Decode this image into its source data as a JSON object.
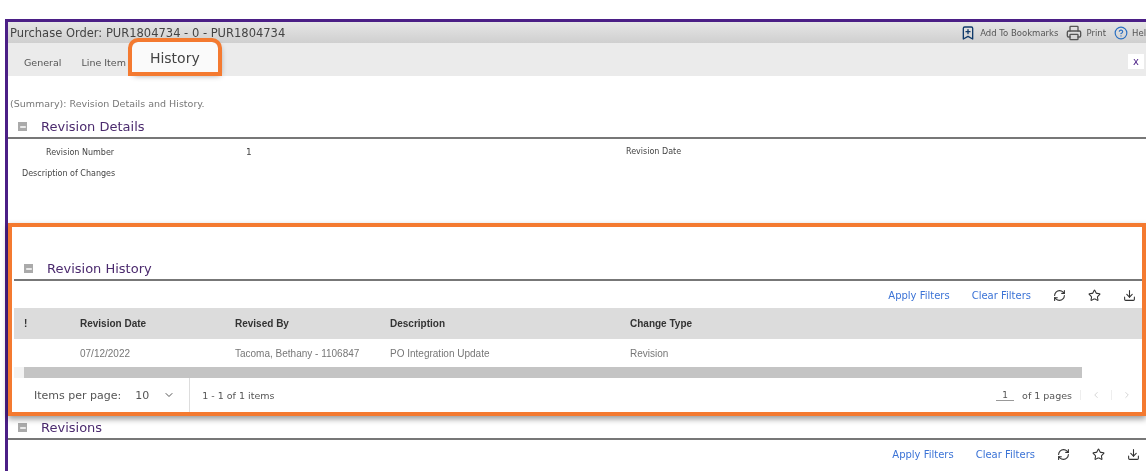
{
  "header": {
    "title": "Purchase Order: PUR1804734 - 0 - PUR1804734",
    "actions": [
      {
        "kind": "bookmark",
        "label": "Add To Bookmarks"
      },
      {
        "kind": "print",
        "label": "Print"
      },
      {
        "kind": "help",
        "label": "Hel"
      }
    ]
  },
  "tabs": [
    {
      "label": "General",
      "selected": false
    },
    {
      "label": "Line Item",
      "selected": false
    },
    {
      "label": "History",
      "selected": true
    }
  ],
  "close_label": "x",
  "summary": "(Summary): Revision Details and History.",
  "revision_details": {
    "title": "Revision Details",
    "fields": [
      {
        "label": "Revision Number",
        "value": "1"
      },
      {
        "label": "Revision Date"
      },
      {
        "label": "Description of Changes"
      }
    ]
  },
  "revision_history": {
    "title": "Revision History",
    "toolbar": [
      "Apply Filters",
      "Clear Filters"
    ],
    "table": {
      "columns": [
        "!",
        "Revision Date",
        "Revised By",
        "Description",
        "Change Type"
      ],
      "rows": [
        [
          "",
          "07/12/2022",
          "Tacoma, Bethany - 1106847",
          "PO Integration Update",
          "Revision"
        ]
      ]
    },
    "pager": {
      "items_per_page_label": "Items per page:",
      "items_per_page": "10",
      "range": "1 - 1 of 1 items",
      "page": "1",
      "pages": "of 1 pages"
    }
  },
  "revisions": {
    "title": "Revisions",
    "toolbar": [
      "Apply Filters",
      "Clear Filters"
    ]
  }
}
